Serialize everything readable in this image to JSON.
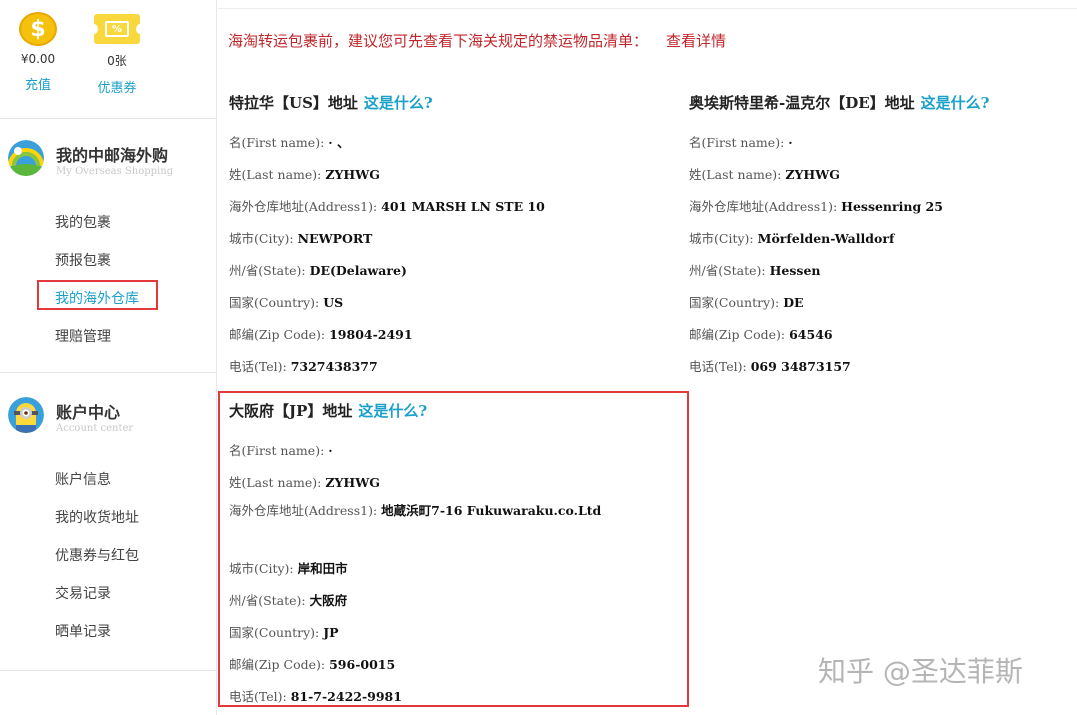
{
  "wallet": {
    "balance_value": "¥0.00",
    "balance_link": "充值",
    "coin_symbol": "$",
    "coupon_value": "0张",
    "coupon_link": "优惠券",
    "coupon_symbol": "%"
  },
  "shopping": {
    "title": "我的中邮海外购",
    "subtitle": "My Overseas Shopping",
    "items": [
      "我的包裹",
      "预报包裹",
      "我的海外仓库",
      "理赔管理"
    ]
  },
  "account": {
    "title": "账户中心",
    "subtitle": "Account center",
    "items": [
      "账户信息",
      "我的收货地址",
      "优惠券与红包",
      "交易记录",
      "晒单记录"
    ]
  },
  "notice": {
    "text": "海淘转运包裹前，建议您可先查看下海关规定的禁运物品清单：",
    "link": "查看详情"
  },
  "what_link": "这是什么?",
  "addresses": {
    "us": {
      "title": "特拉华【US】地址",
      "first_name_label": "名(First name):",
      "first_name": "·  、",
      "last_name_label": "姓(Last name):",
      "last_name": "ZYHWG",
      "address1_label": "海外仓库地址(Address1):",
      "address1": "401 MARSH LN STE 10",
      "city_label": "城市(City):",
      "city": "NEWPORT",
      "state_label": "州/省(State):",
      "state": "DE(Delaware)",
      "country_label": "国家(Country):",
      "country": "US",
      "zip_label": "邮编(Zip Code):",
      "zip": "19804-2491",
      "tel_label": "电话(Tel):",
      "tel": "7327438377"
    },
    "de": {
      "title": "奥埃斯特里希-温克尔【DE】地址",
      "first_name_label": "名(First name):",
      "first_name": "·",
      "last_name_label": "姓(Last name):",
      "last_name": "ZYHWG",
      "address1_label": "海外仓库地址(Address1):",
      "address1": "Hessenring 25",
      "city_label": "城市(City):",
      "city": "Mörfelden-Walldorf",
      "state_label": "州/省(State):",
      "state": "Hessen",
      "country_label": "国家(Country):",
      "country": "DE",
      "zip_label": "邮编(Zip Code):",
      "zip": "64546",
      "tel_label": "电话(Tel):",
      "tel": "069 34873157"
    },
    "jp": {
      "title": "大阪府【JP】地址",
      "first_name_label": "名(First name):",
      "first_name": "·",
      "last_name_label": "姓(Last name):",
      "last_name": "ZYHWG",
      "address1_label": "海外仓库地址(Address1):",
      "address1": "地蔵浜町7-16 Fukuwaraku.co.Ltd",
      "city_label": "城市(City):",
      "city": "岸和田市",
      "state_label": "州/省(State):",
      "state": "大阪府",
      "country_label": "国家(Country):",
      "country": "JP",
      "zip_label": "邮编(Zip Code):",
      "zip": "596-0015",
      "tel_label": "电话(Tel):",
      "tel": "81-7-2422-9981"
    }
  },
  "watermark": "知乎 @圣达菲斯",
  "colors": {
    "accent": "#1ba1c9",
    "notice_red": "#c0262b",
    "highlight_red": "#e23a3a",
    "coin_yellow": "#f4c20d"
  },
  "icons": {
    "balance": "coin-icon",
    "coupon": "coupon-ticket-icon",
    "shopping": "rainbow-globe-icon",
    "account": "minion-avatar-icon"
  }
}
